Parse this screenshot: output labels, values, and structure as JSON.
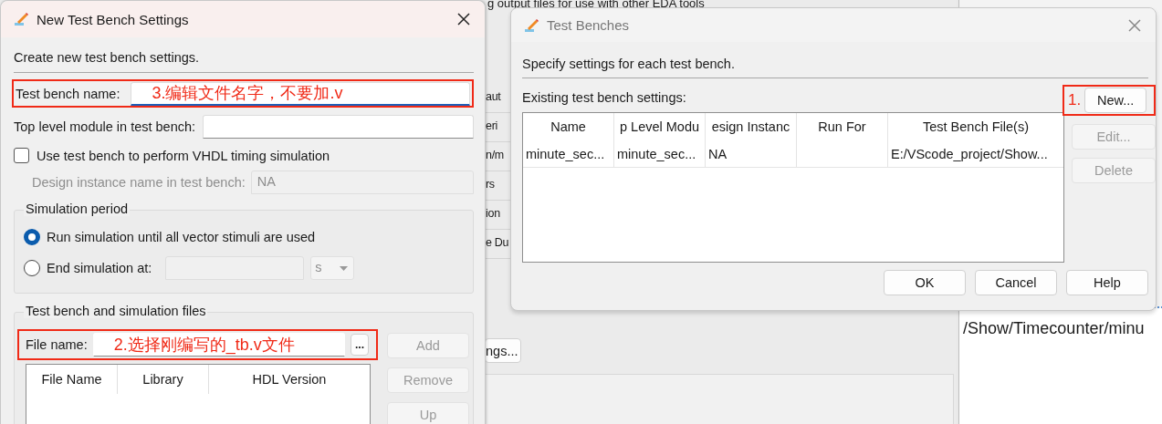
{
  "background_window": {
    "header_text": "g output files for use with other EDA tools",
    "side_labels": [
      "aut",
      "eri",
      "n/m",
      "rs",
      "ion",
      "e Du"
    ],
    "settings_button": "ngs...",
    "path_text": "/Show/Timecounter/minu"
  },
  "new_dialog": {
    "title": "New Test Bench Settings",
    "intro": "Create new test bench settings.",
    "test_bench_name": {
      "label": "Test bench name:",
      "annotation": "3.编辑文件名字，不要加.v",
      "focused": true
    },
    "top_level_module": {
      "label": "Top level module in test bench:",
      "focused": false
    },
    "vhdl_timing": {
      "label": "Use test bench to perform VHDL timing simulation",
      "checked": false
    },
    "design_instance": {
      "label": "Design instance name in test bench:",
      "value": "NA",
      "disabled": true
    },
    "simulation_period": {
      "title": "Simulation period",
      "options": [
        {
          "label": "Run simulation until all vector stimuli are used",
          "selected": true
        },
        {
          "label": "End simulation at:",
          "selected": false
        }
      ],
      "end_time": {
        "disabled": true
      },
      "unit": {
        "value": "s",
        "disabled": true
      }
    },
    "files": {
      "title": "Test bench and simulation files",
      "file_name": {
        "label": "File name:",
        "annotation": "2.选择刚编写的_tb.v文件"
      },
      "browse_button": "...",
      "columns": [
        "File Name",
        "Library",
        "HDL Version"
      ],
      "buttons": [
        {
          "label": "Add",
          "disabled": true
        },
        {
          "label": "Remove",
          "disabled": true
        },
        {
          "label": "Up",
          "disabled": true
        }
      ]
    }
  },
  "benches_dialog": {
    "title": "Test Benches",
    "intro": "Specify settings for each test bench.",
    "table_label": "Existing test bench settings:",
    "columns": [
      "Name",
      "p Level Modu",
      "esign Instanc",
      "Run For",
      "Test Bench File(s)"
    ],
    "rows": [
      {
        "name": "minute_sec...",
        "top_level_module": "minute_sec...",
        "design_instance": "NA",
        "test_bench_files": "E:/VScode_project/Show..."
      }
    ],
    "side_buttons": [
      {
        "label": "New...",
        "disabled": false,
        "annotation": "1."
      },
      {
        "label": "Edit...",
        "disabled": true
      },
      {
        "label": "Delete",
        "disabled": true
      }
    ],
    "footer_buttons": [
      "OK",
      "Cancel",
      "Help"
    ]
  }
}
